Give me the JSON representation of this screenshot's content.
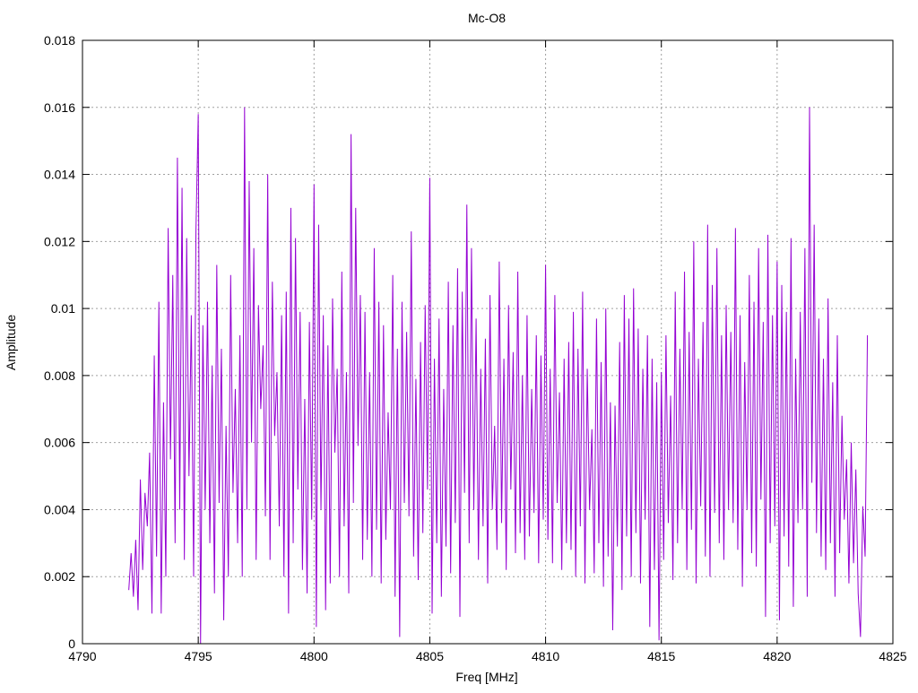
{
  "chart_data": {
    "type": "line",
    "title": "Mc-O8",
    "xlabel": "Freq [MHz]",
    "ylabel": "Amplitude",
    "xlim": [
      4790,
      4825
    ],
    "ylim": [
      0,
      0.018
    ],
    "grid": true,
    "x_ticks": [
      "4790",
      "4795",
      "4800",
      "4805",
      "4810",
      "4815",
      "4820",
      "4825"
    ],
    "y_ticks": [
      "0",
      "0.002",
      "0.004",
      "0.006",
      "0.008",
      "0.01",
      "0.012",
      "0.014",
      "0.016",
      "0.018"
    ],
    "series": [
      {
        "name": "Mc-O8",
        "color": "#9400d3",
        "x_start": 4792.0,
        "x_step": 0.1,
        "values": [
          0.0016,
          0.0027,
          0.0014,
          0.0031,
          0.001,
          0.0049,
          0.0022,
          0.0045,
          0.0035,
          0.0057,
          0.0009,
          0.0086,
          0.0026,
          0.0102,
          0.0009,
          0.0072,
          0.002,
          0.0124,
          0.0055,
          0.011,
          0.003,
          0.0145,
          0.004,
          0.0136,
          0.0025,
          0.0121,
          0.005,
          0.0098,
          0.002,
          0.0123,
          0.0158,
          0.0,
          0.0095,
          0.004,
          0.0102,
          0.003,
          0.0083,
          0.0015,
          0.0113,
          0.0042,
          0.0088,
          0.0007,
          0.0065,
          0.002,
          0.011,
          0.0045,
          0.0076,
          0.003,
          0.0092,
          0.002,
          0.016,
          0.004,
          0.0138,
          0.006,
          0.0118,
          0.0025,
          0.0101,
          0.007,
          0.0089,
          0.0038,
          0.014,
          0.0025,
          0.0108,
          0.0062,
          0.0081,
          0.0035,
          0.0098,
          0.002,
          0.0105,
          0.0009,
          0.013,
          0.003,
          0.0121,
          0.0046,
          0.0099,
          0.0022,
          0.0073,
          0.0015,
          0.0096,
          0.0037,
          0.0137,
          0.0005,
          0.0125,
          0.004,
          0.0098,
          0.001,
          0.0089,
          0.0018,
          0.0103,
          0.0057,
          0.0082,
          0.002,
          0.0111,
          0.0035,
          0.0081,
          0.0015,
          0.0152,
          0.0042,
          0.013,
          0.0059,
          0.0104,
          0.0025,
          0.0099,
          0.0031,
          0.0081,
          0.002,
          0.0118,
          0.0034,
          0.0102,
          0.0018,
          0.0095,
          0.0031,
          0.0069,
          0.004,
          0.011,
          0.0014,
          0.0088,
          0.0002,
          0.0102,
          0.0042,
          0.0093,
          0.0038,
          0.0123,
          0.0026,
          0.0079,
          0.0019,
          0.009,
          0.0033,
          0.0101,
          0.0046,
          0.0139,
          0.0009,
          0.0085,
          0.003,
          0.0097,
          0.0014,
          0.0076,
          0.0029,
          0.0108,
          0.0021,
          0.0095,
          0.0036,
          0.0112,
          0.0008,
          0.0105,
          0.0045,
          0.0131,
          0.003,
          0.0118,
          0.004,
          0.0097,
          0.0025,
          0.0082,
          0.0035,
          0.0091,
          0.0018,
          0.0104,
          0.004,
          0.0065,
          0.0028,
          0.0114,
          0.0036,
          0.0085,
          0.0022,
          0.0101,
          0.0046,
          0.0087,
          0.0027,
          0.0111,
          0.0033,
          0.008,
          0.0025,
          0.0098,
          0.0032,
          0.0076,
          0.0039,
          0.0092,
          0.0024,
          0.0086,
          0.0037,
          0.0113,
          0.0031,
          0.0082,
          0.0024,
          0.0104,
          0.0042,
          0.0075,
          0.0022,
          0.0085,
          0.003,
          0.009,
          0.0028,
          0.0099,
          0.002,
          0.0088,
          0.0035,
          0.0105,
          0.0018,
          0.0082,
          0.004,
          0.0064,
          0.0021,
          0.0097,
          0.003,
          0.0084,
          0.0017,
          0.01,
          0.0026,
          0.0072,
          0.0004,
          0.0071,
          0.0029,
          0.009,
          0.0016,
          0.0104,
          0.0032,
          0.0097,
          0.002,
          0.0106,
          0.0033,
          0.0094,
          0.0018,
          0.0082,
          0.0037,
          0.0092,
          0.0005,
          0.0085,
          0.0022,
          0.0078,
          0.0001,
          0.0081,
          0.0025,
          0.0092,
          0.0036,
          0.0074,
          0.0019,
          0.0105,
          0.003,
          0.0088,
          0.004,
          0.0111,
          0.0022,
          0.0093,
          0.0034,
          0.012,
          0.0018,
          0.0085,
          0.0041,
          0.0096,
          0.0026,
          0.0125,
          0.002,
          0.0107,
          0.0039,
          0.0118,
          0.003,
          0.0092,
          0.0025,
          0.0101,
          0.004,
          0.0093,
          0.0036,
          0.0124,
          0.0028,
          0.0098,
          0.0017,
          0.0084,
          0.004,
          0.011,
          0.0027,
          0.0102,
          0.0023,
          0.0118,
          0.0043,
          0.0096,
          0.0008,
          0.0122,
          0.003,
          0.0098,
          0.0035,
          0.0114,
          0.0007,
          0.0107,
          0.0032,
          0.0099,
          0.0023,
          0.0121,
          0.0011,
          0.0085,
          0.0036,
          0.0099,
          0.004,
          0.0118,
          0.0014,
          0.016,
          0.0048,
          0.0125,
          0.0033,
          0.0097,
          0.0026,
          0.0085,
          0.0022,
          0.0103,
          0.003,
          0.0078,
          0.0014,
          0.0092,
          0.0027,
          0.0068,
          0.0037,
          0.0055,
          0.0018,
          0.006,
          0.0024,
          0.0052,
          0.0015,
          0.0002,
          0.0041,
          0.0026,
          0.0092
        ]
      }
    ]
  }
}
